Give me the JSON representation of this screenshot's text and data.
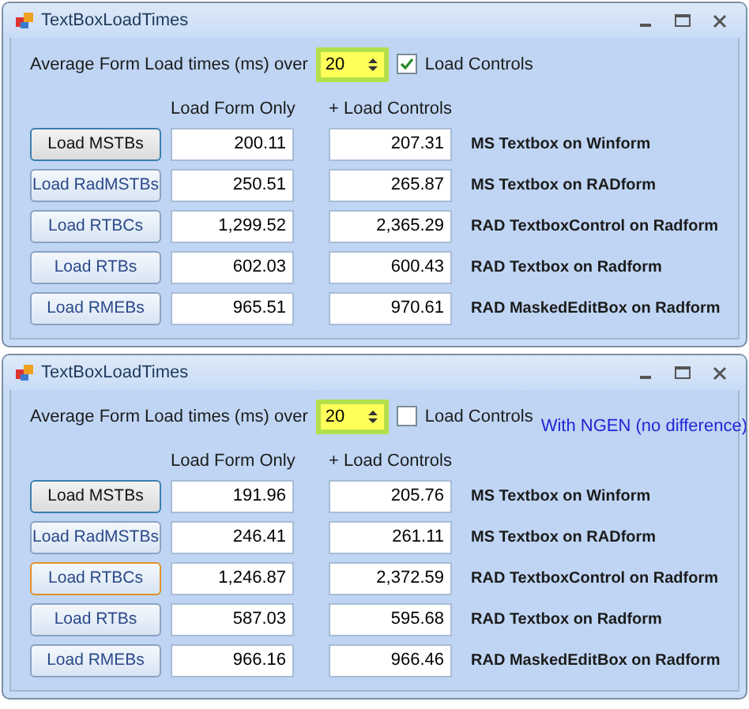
{
  "windows": [
    {
      "title": "TextBoxLoadTimes",
      "iterations_label": "Average Form Load times (ms) over",
      "iterations": "20",
      "load_controls": {
        "label": "Load Controls",
        "checked": true
      },
      "columns": [
        "Load Form Only",
        "+ Load Controls"
      ],
      "rows": [
        {
          "button": "Load MSTBs",
          "kind": "default",
          "form_only": "200.11",
          "with_controls": "207.31",
          "description": "MS Textbox on Winform"
        },
        {
          "button": "Load RadMSTBs",
          "kind": "normal",
          "form_only": "250.51",
          "with_controls": "265.87",
          "description": "MS Textbox on RADform"
        },
        {
          "button": "Load RTBCs",
          "kind": "normal",
          "form_only": "1,299.52",
          "with_controls": "2,365.29",
          "description": "RAD TextboxControl on Radform"
        },
        {
          "button": "Load RTBs",
          "kind": "normal",
          "form_only": "602.03",
          "with_controls": "600.43",
          "description": "RAD Textbox on Radform"
        },
        {
          "button": "Load RMEBs",
          "kind": "normal",
          "form_only": "965.51",
          "with_controls": "970.61",
          "description": "RAD MaskedEditBox on Radform"
        }
      ]
    },
    {
      "title": "TextBoxLoadTimes",
      "iterations_label": "Average Form Load times (ms) over",
      "iterations": "20",
      "load_controls": {
        "label": "Load Controls",
        "checked": false
      },
      "note": "With NGEN (no difference)",
      "columns": [
        "Load Form Only",
        "+ Load Controls"
      ],
      "rows": [
        {
          "button": "Load MSTBs",
          "kind": "default",
          "form_only": "191.96",
          "with_controls": "205.76",
          "description": "MS Textbox on Winform"
        },
        {
          "button": "Load RadMSTBs",
          "kind": "normal",
          "form_only": "246.41",
          "with_controls": "261.11",
          "description": "MS Textbox on RADform"
        },
        {
          "button": "Load RTBCs",
          "kind": "hover",
          "form_only": "1,246.87",
          "with_controls": "2,372.59",
          "description": "RAD TextboxControl on Radform"
        },
        {
          "button": "Load RTBs",
          "kind": "normal",
          "form_only": "587.03",
          "with_controls": "595.68",
          "description": "RAD Textbox on Radform"
        },
        {
          "button": "Load RMEBs",
          "kind": "normal",
          "form_only": "966.16",
          "with_controls": "966.46",
          "description": "RAD MaskedEditBox on Radform"
        }
      ]
    }
  ]
}
